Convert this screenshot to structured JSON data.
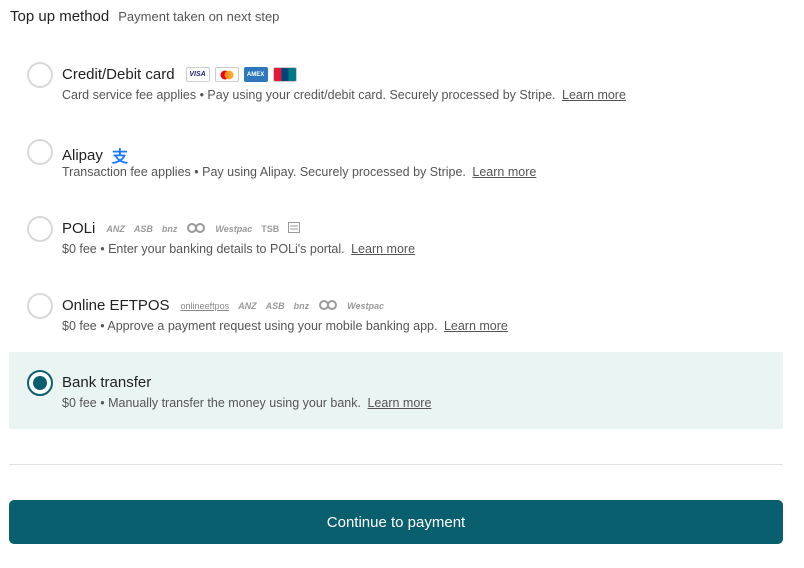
{
  "header": {
    "title": "Top up method",
    "subtitle": "Payment taken on next step"
  },
  "learn_more": "Learn more",
  "colors": {
    "accent": "#0a5f6e",
    "selected_bg": "#eaf4f2"
  },
  "options": [
    {
      "title": "Credit/Debit card",
      "desc": "Card service fee applies • Pay using your credit/debit card. Securely processed by Stripe.",
      "selected": false,
      "logos": [
        "VISA",
        "mastercard",
        "AMEX",
        "UnionPay"
      ]
    },
    {
      "title": "Alipay",
      "desc": "Transaction fee applies • Pay using Alipay. Securely processed by Stripe.",
      "selected": false,
      "icon": "支"
    },
    {
      "title": "POLi",
      "desc": "$0 fee • Enter your banking details to POLi's portal.",
      "selected": false,
      "banks": [
        "ANZ",
        "ASB",
        "bnz",
        "Kiwibank",
        "Westpac",
        "TSB",
        "Co-op"
      ]
    },
    {
      "title": "Online EFTPOS",
      "desc": "$0 fee • Approve a payment request using your mobile banking app.",
      "selected": false,
      "eftpos_mark": "onlineeftpos",
      "banks": [
        "ANZ",
        "ASB",
        "bnz",
        "Kiwibank",
        "Westpac"
      ]
    },
    {
      "title": "Bank transfer",
      "desc": "$0 fee • Manually transfer the money using your bank.",
      "selected": true
    }
  ],
  "continue_label": "Continue to payment"
}
